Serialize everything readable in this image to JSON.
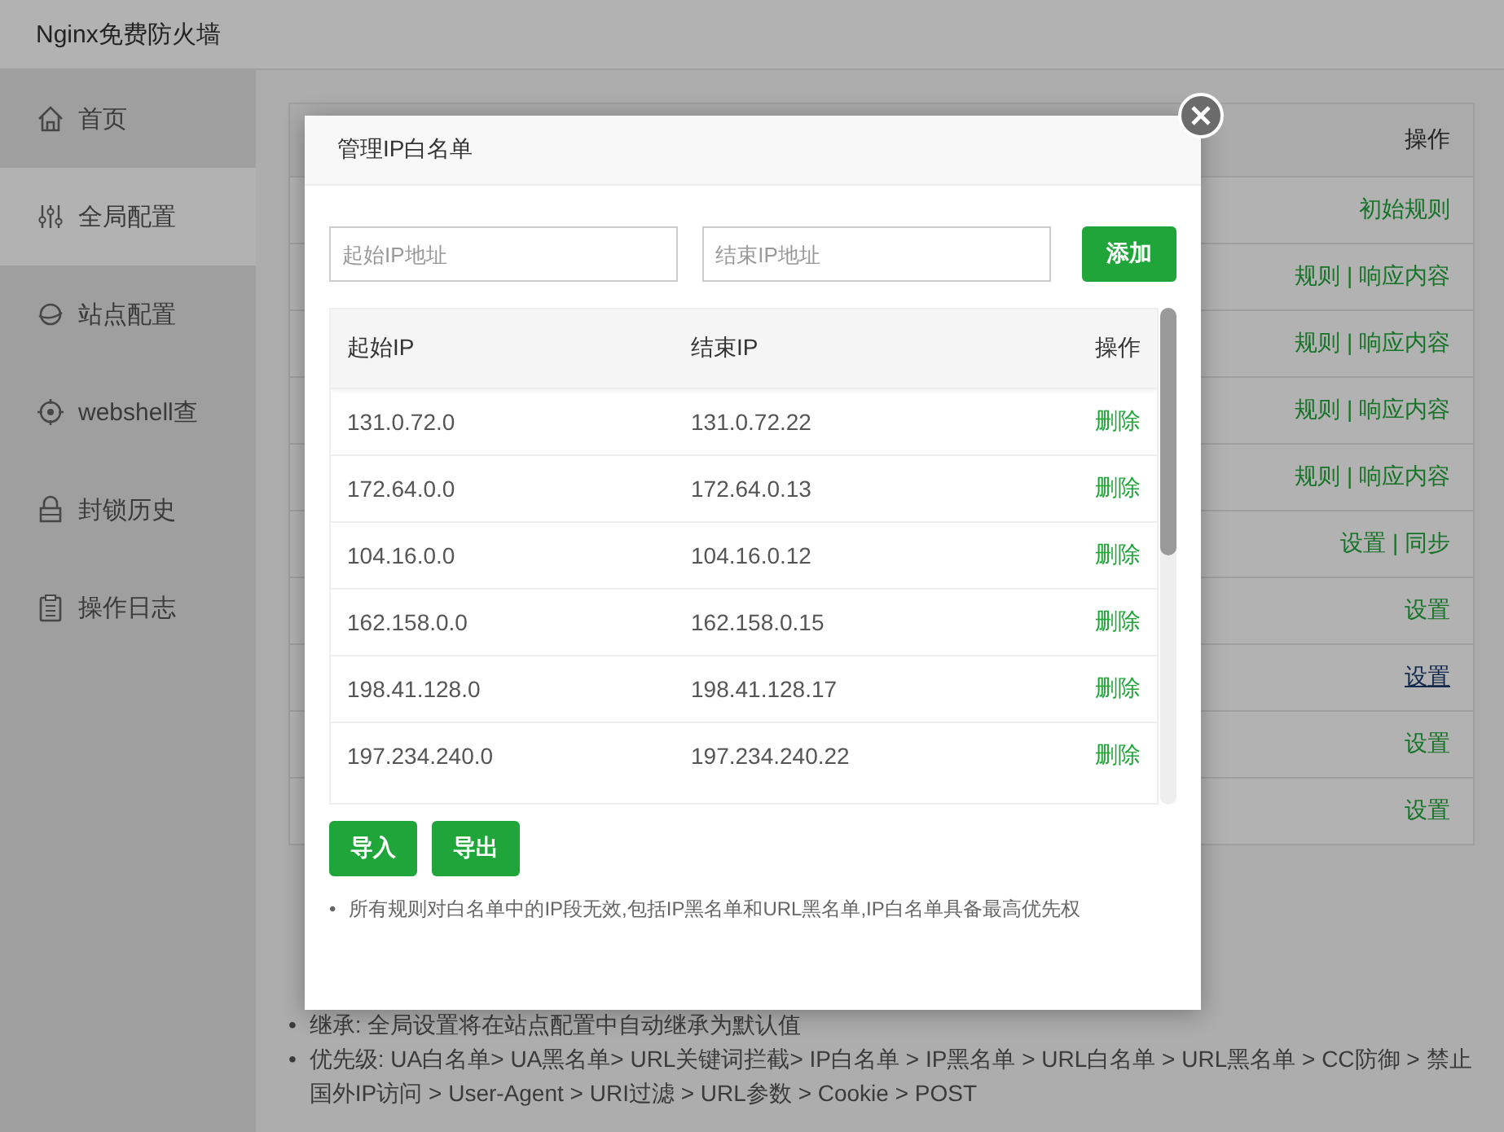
{
  "window": {
    "title": "Nginx免费防火墙"
  },
  "sidebar": {
    "items": [
      {
        "label": "首页",
        "selected": false
      },
      {
        "label": "全局配置",
        "selected": true
      },
      {
        "label": "站点配置",
        "selected": false
      },
      {
        "label": "webshell查",
        "selected": false
      },
      {
        "label": "封锁历史",
        "selected": false
      },
      {
        "label": "操作日志",
        "selected": false
      }
    ]
  },
  "table": {
    "columns": [
      "操作"
    ],
    "rows": [
      {
        "actions": "初始规则",
        "hovered": false
      },
      {
        "actions": "规则 | 响应内容",
        "hovered": false
      },
      {
        "actions": "规则 | 响应内容",
        "hovered": false
      },
      {
        "actions": "规则 | 响应内容",
        "hovered": false
      },
      {
        "actions": "规则 | 响应内容",
        "hovered": false
      },
      {
        "actions": "设置 | 同步",
        "hovered": false
      },
      {
        "actions": "设置",
        "hovered": false
      },
      {
        "actions": "设置",
        "hovered": true
      },
      {
        "actions": "设置",
        "hovered": false
      },
      {
        "actions": "设置",
        "hovered": false
      }
    ]
  },
  "notes": [
    {
      "bullet": "•",
      "text": "继承: 全局设置将在站点配置中自动继承为默认值"
    },
    {
      "bullet": "•",
      "text": "优先级: UA白名单> UA黑名单> URL关键词拦截> IP白名单 > IP黑名单 > URL白名单 > URL黑名单 > CC防御 > 禁止国外IP访问 > User-Agent > URI过滤 > URL参数 > Cookie > POST"
    }
  ],
  "dialog": {
    "title": "管理IP白名单",
    "start_field": {
      "placeholder": "起始IP地址"
    },
    "end_field": {
      "placeholder": "结束IP地址"
    },
    "add_button": "添加",
    "columns": [
      "起始IP",
      "结束IP",
      "操作"
    ],
    "rows": [
      {
        "start": "131.0.72.0",
        "end": "131.0.72.22",
        "action": "删除"
      },
      {
        "start": "172.64.0.0",
        "end": "172.64.0.13",
        "action": "删除"
      },
      {
        "start": "104.16.0.0",
        "end": "104.16.0.12",
        "action": "删除"
      },
      {
        "start": "162.158.0.0",
        "end": "162.158.0.15",
        "action": "删除"
      },
      {
        "start": "198.41.128.0",
        "end": "198.41.128.17",
        "action": "删除"
      },
      {
        "start": "197.234.240.0",
        "end": "197.234.240.22",
        "action": "删除"
      }
    ],
    "buttons": [
      "导入",
      "导出"
    ],
    "note": {
      "bullet": "•",
      "text": "所有规则对白名单中的IP段无效,包括IP黑名单和URL黑名单,IP白名单具备最高优先权"
    }
  }
}
